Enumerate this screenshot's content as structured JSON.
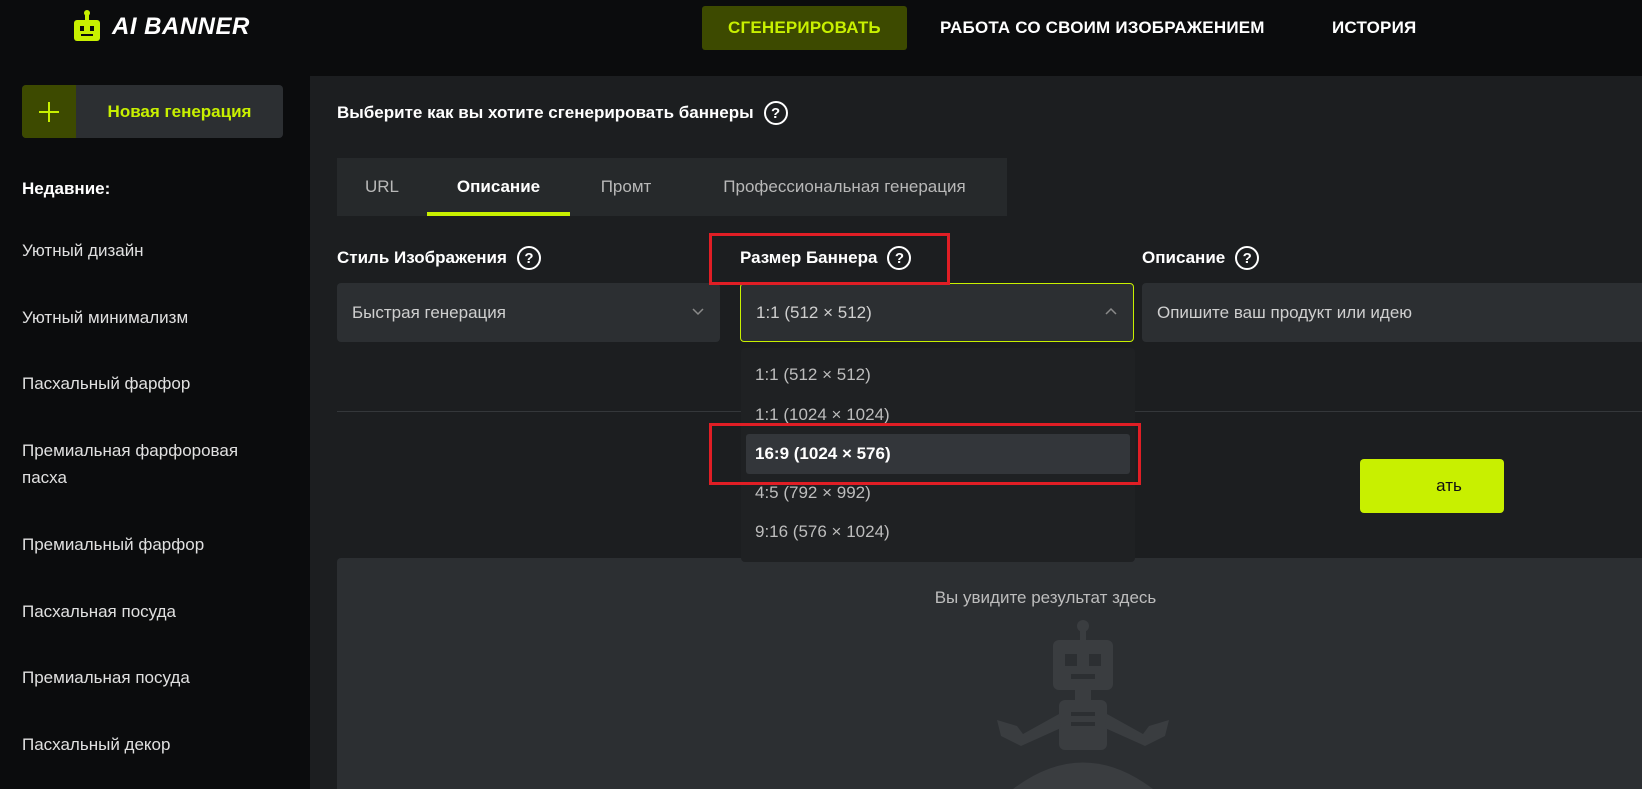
{
  "header": {
    "logo_text": "AI BANNER",
    "nav": [
      {
        "label": "СГЕНЕРИРОВАТЬ",
        "active": true
      },
      {
        "label": "РАБОТА СО СВОИМ ИЗОБРАЖЕНИЕМ",
        "active": false
      },
      {
        "label": "ИСТОРИЯ",
        "active": false
      }
    ]
  },
  "sidebar": {
    "new_generation_label": "Новая генерация",
    "recent_title": "Недавние:",
    "items": [
      {
        "label": "Уютный дизайн"
      },
      {
        "label": "Уютный минимализм"
      },
      {
        "label": "Пасхальный фарфор"
      },
      {
        "label": "Премиальная фарфоровая пасха"
      },
      {
        "label": "Премиальный фарфор"
      },
      {
        "label": "Пасхальная посуда"
      },
      {
        "label": "Премиальная посуда"
      },
      {
        "label": "Пасхальный декор"
      }
    ]
  },
  "main": {
    "question": "Выберите как вы хотите сгенерировать баннеры",
    "tabs": [
      {
        "label": "URL",
        "active": false
      },
      {
        "label": "Описание",
        "active": true
      },
      {
        "label": "Промт",
        "active": false
      },
      {
        "label": "Профессиональная генерация",
        "active": false
      }
    ],
    "style_field": {
      "label": "Стиль Изображения",
      "value": "Быстрая генерация"
    },
    "size_field": {
      "label": "Размер Баннера",
      "value": "1:1 (512 × 512)"
    },
    "description_field": {
      "label": "Описание",
      "placeholder": "Опишите ваш продукт или идею"
    },
    "generate_button_label": "ать",
    "result_placeholder": "Вы увидите результат здесь",
    "size_options": [
      {
        "label": "1:1 (512 × 512)",
        "selected": false
      },
      {
        "label": "1:1 (1024 × 1024)",
        "selected": false
      },
      {
        "label": "16:9 (1024 × 576)",
        "selected": true
      },
      {
        "label": "4:5 (792 × 992)",
        "selected": false
      },
      {
        "label": "9:16 (576 × 1024)",
        "selected": false
      }
    ]
  },
  "colors": {
    "accent": "#c8f000",
    "accent_dark": "#3d4a00",
    "annotation": "#e01e25"
  }
}
